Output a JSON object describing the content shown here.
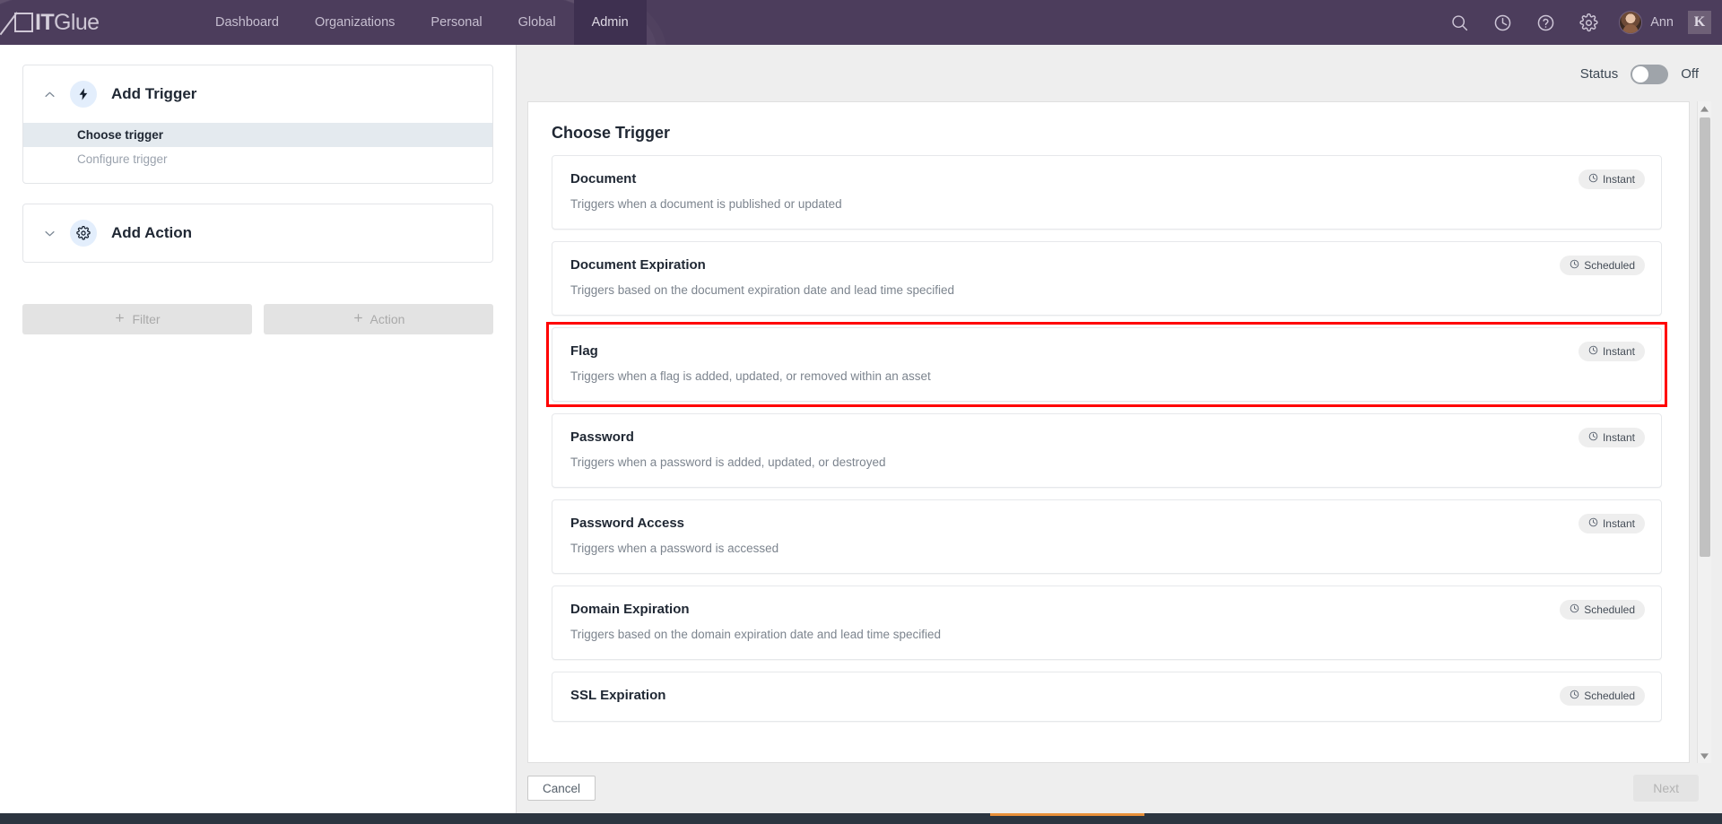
{
  "topnav": {
    "brand": {
      "it": "IT",
      "glue": "Glue",
      "icon": "itglue-logo-icon"
    },
    "tabs": [
      {
        "label": "Dashboard",
        "active": false
      },
      {
        "label": "Organizations",
        "active": false
      },
      {
        "label": "Personal",
        "active": false
      },
      {
        "label": "Global",
        "active": false
      },
      {
        "label": "Admin",
        "active": true
      }
    ],
    "icons": [
      "search-icon",
      "history-clock-icon",
      "help-question-icon",
      "gear-icon"
    ],
    "user": {
      "name": "Ann",
      "avatar": "user-avatar"
    },
    "app_badge": "K"
  },
  "left": {
    "trigger_card": {
      "title": "Add Trigger",
      "icon": "lightning-bolt-icon",
      "chevron": "chevron-up-icon",
      "items": [
        {
          "label": "Choose trigger",
          "selected": true
        },
        {
          "label": "Configure trigger",
          "selected": false
        }
      ]
    },
    "action_card": {
      "title": "Add Action",
      "icon": "gear-icon",
      "chevron": "chevron-down-icon"
    },
    "buttons": [
      {
        "label": "Filter",
        "icon": "plus-icon",
        "disabled": true
      },
      {
        "label": "Action",
        "icon": "plus-icon",
        "disabled": true
      }
    ]
  },
  "right": {
    "status": {
      "label": "Status",
      "value": "Off",
      "on": false
    },
    "panel_title": "Choose Trigger",
    "triggers": [
      {
        "name": "Document",
        "description": "Triggers when a document is published or updated",
        "badge": "Instant",
        "highlighted": false
      },
      {
        "name": "Document Expiration",
        "description": "Triggers based on the document expiration date and lead time specified",
        "badge": "Scheduled",
        "highlighted": false
      },
      {
        "name": "Flag",
        "description": "Triggers when a flag is added, updated, or removed within an asset",
        "badge": "Instant",
        "highlighted": true
      },
      {
        "name": "Password",
        "description": "Triggers when a password is added, updated, or destroyed",
        "badge": "Instant",
        "highlighted": false
      },
      {
        "name": "Password Access",
        "description": "Triggers when a password is accessed",
        "badge": "Instant",
        "highlighted": false
      },
      {
        "name": "Domain Expiration",
        "description": "Triggers based on the domain expiration date and lead time specified",
        "badge": "Scheduled",
        "highlighted": false
      },
      {
        "name": "SSL Expiration",
        "description": "",
        "badge": "Scheduled",
        "highlighted": false
      }
    ],
    "footer": {
      "cancel_label": "Cancel",
      "next_label": "Next",
      "next_disabled": true
    },
    "scrollbar": {
      "up": "scroll-up-arrow",
      "down": "scroll-down-arrow"
    }
  },
  "colors": {
    "nav_purple": "#4c3d5c",
    "nav_active": "#3e3050",
    "annotation_red": "#ff0000",
    "icon_circle": "#e3eefc",
    "selected_row": "#e4eaef"
  }
}
